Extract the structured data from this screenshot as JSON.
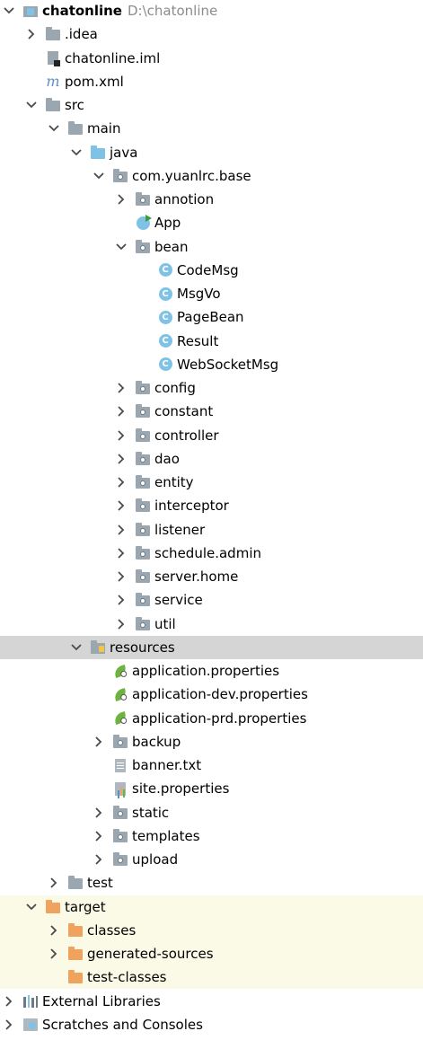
{
  "tree": {
    "project_name": "chatonline",
    "project_path": "D:\\chatonline",
    "items": [
      {
        "label": "chatonline",
        "path": "D:\\chatonline",
        "level": 0,
        "arrow": "down",
        "icon": "module-folder-icon",
        "bold": true
      },
      {
        "label": ".idea",
        "level": 1,
        "arrow": "right",
        "icon": "folder-icon"
      },
      {
        "label": "chatonline.iml",
        "level": 1,
        "arrow": "none",
        "icon": "iml-file-icon"
      },
      {
        "label": "pom.xml",
        "level": 1,
        "arrow": "none",
        "icon": "maven-icon"
      },
      {
        "label": "src",
        "level": 1,
        "arrow": "down",
        "icon": "folder-icon"
      },
      {
        "label": "main",
        "level": 2,
        "arrow": "down",
        "icon": "folder-icon"
      },
      {
        "label": "java",
        "level": 3,
        "arrow": "down",
        "icon": "source-folder-icon"
      },
      {
        "label": "com.yuanlrc.base",
        "level": 4,
        "arrow": "down",
        "icon": "package-icon"
      },
      {
        "label": "annotion",
        "level": 5,
        "arrow": "right",
        "icon": "package-icon"
      },
      {
        "label": "App",
        "level": 5,
        "arrow": "none",
        "icon": "spring-app-class-icon"
      },
      {
        "label": "bean",
        "level": 5,
        "arrow": "down",
        "icon": "package-icon"
      },
      {
        "label": "CodeMsg",
        "level": 6,
        "arrow": "none",
        "icon": "class-icon"
      },
      {
        "label": "MsgVo",
        "level": 6,
        "arrow": "none",
        "icon": "class-icon"
      },
      {
        "label": "PageBean",
        "level": 6,
        "arrow": "none",
        "icon": "class-icon"
      },
      {
        "label": "Result",
        "level": 6,
        "arrow": "none",
        "icon": "class-icon"
      },
      {
        "label": "WebSocketMsg",
        "level": 6,
        "arrow": "none",
        "icon": "class-icon"
      },
      {
        "label": "config",
        "level": 5,
        "arrow": "right",
        "icon": "package-icon"
      },
      {
        "label": "constant",
        "level": 5,
        "arrow": "right",
        "icon": "package-icon"
      },
      {
        "label": "controller",
        "level": 5,
        "arrow": "right",
        "icon": "package-icon"
      },
      {
        "label": "dao",
        "level": 5,
        "arrow": "right",
        "icon": "package-icon"
      },
      {
        "label": "entity",
        "level": 5,
        "arrow": "right",
        "icon": "package-icon"
      },
      {
        "label": "interceptor",
        "level": 5,
        "arrow": "right",
        "icon": "package-icon"
      },
      {
        "label": "listener",
        "level": 5,
        "arrow": "right",
        "icon": "package-icon"
      },
      {
        "label": "schedule.admin",
        "level": 5,
        "arrow": "right",
        "icon": "package-icon"
      },
      {
        "label": "server.home",
        "level": 5,
        "arrow": "right",
        "icon": "package-icon"
      },
      {
        "label": "service",
        "level": 5,
        "arrow": "right",
        "icon": "package-icon"
      },
      {
        "label": "util",
        "level": 5,
        "arrow": "right",
        "icon": "package-icon"
      },
      {
        "label": "resources",
        "level": 3,
        "arrow": "down",
        "icon": "resources-folder-icon",
        "selected": true
      },
      {
        "label": "application.properties",
        "level": 4,
        "arrow": "none",
        "icon": "spring-properties-icon"
      },
      {
        "label": "application-dev.properties",
        "level": 4,
        "arrow": "none",
        "icon": "spring-properties-icon"
      },
      {
        "label": "application-prd.properties",
        "level": 4,
        "arrow": "none",
        "icon": "spring-properties-icon"
      },
      {
        "label": "backup",
        "level": 4,
        "arrow": "right",
        "icon": "package-icon"
      },
      {
        "label": "banner.txt",
        "level": 4,
        "arrow": "none",
        "icon": "text-file-icon"
      },
      {
        "label": "site.properties",
        "level": 4,
        "arrow": "none",
        "icon": "properties-file-icon"
      },
      {
        "label": "static",
        "level": 4,
        "arrow": "right",
        "icon": "package-icon"
      },
      {
        "label": "templates",
        "level": 4,
        "arrow": "right",
        "icon": "package-icon"
      },
      {
        "label": "upload",
        "level": 4,
        "arrow": "right",
        "icon": "package-icon"
      },
      {
        "label": "test",
        "level": 2,
        "arrow": "right",
        "icon": "folder-icon"
      },
      {
        "label": "target",
        "level": 1,
        "arrow": "down",
        "icon": "excluded-folder-icon",
        "excluded": true
      },
      {
        "label": "classes",
        "level": 2,
        "arrow": "right",
        "icon": "excluded-folder-icon",
        "excluded": true
      },
      {
        "label": "generated-sources",
        "level": 2,
        "arrow": "right",
        "icon": "excluded-folder-icon",
        "excluded": true
      },
      {
        "label": "test-classes",
        "level": 2,
        "arrow": "none",
        "icon": "excluded-folder-icon",
        "excluded": true
      },
      {
        "label": "External Libraries",
        "level": 0,
        "arrow": "right",
        "icon": "external-libraries-icon"
      },
      {
        "label": "Scratches and Consoles",
        "level": 0,
        "arrow": "right",
        "icon": "scratches-icon"
      }
    ]
  },
  "colors": {
    "selected_bg": "#d5d5d5",
    "excluded_bg": "#fbfae6",
    "folder_gray": "#9aa7b0",
    "source_blue": "#7ec3e6",
    "excluded_orange": "#f0a35e",
    "spring_green": "#6db33f",
    "path_gray": "#8c8c8c"
  }
}
